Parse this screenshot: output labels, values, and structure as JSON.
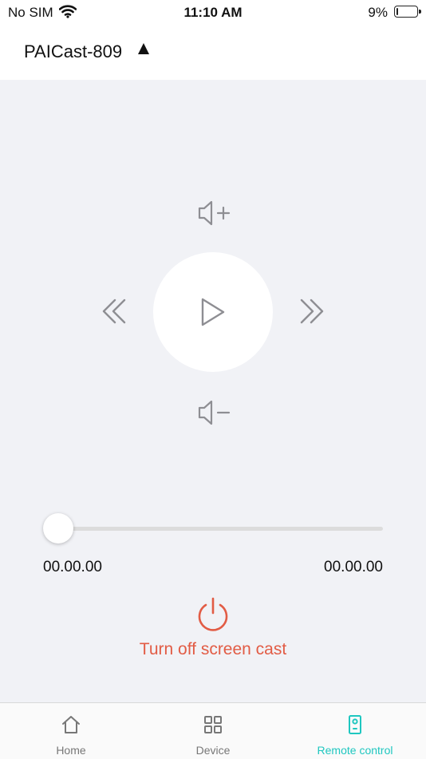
{
  "status_bar": {
    "carrier": "No SIM",
    "time": "11:10 AM",
    "battery_percent": "9%",
    "battery_level": 0.09,
    "icons": [
      "wifi-icon",
      "battery-icon"
    ]
  },
  "header": {
    "device_name": "PAICast-809",
    "dropdown_icon": "triangle-up-icon"
  },
  "remote": {
    "buttons": [
      "volume-up-icon",
      "rewind-icon",
      "play-icon",
      "fast-forward-icon",
      "volume-down-icon"
    ]
  },
  "playback": {
    "current_time": "00.00.00",
    "total_time": "00.00.00",
    "progress": 0
  },
  "power": {
    "label": "Turn off screen cast",
    "icon": "power-icon",
    "color": "#e25c45"
  },
  "tabs": [
    {
      "label": "Home",
      "icon": "home-icon",
      "active": false
    },
    {
      "label": "Device",
      "icon": "grid-icon",
      "active": false
    },
    {
      "label": "Remote control",
      "icon": "remote-icon",
      "active": true
    }
  ],
  "colors": {
    "accent": "#1fc7c0",
    "icon_gray": "#8e8e93",
    "background": "#f1f2f6"
  }
}
